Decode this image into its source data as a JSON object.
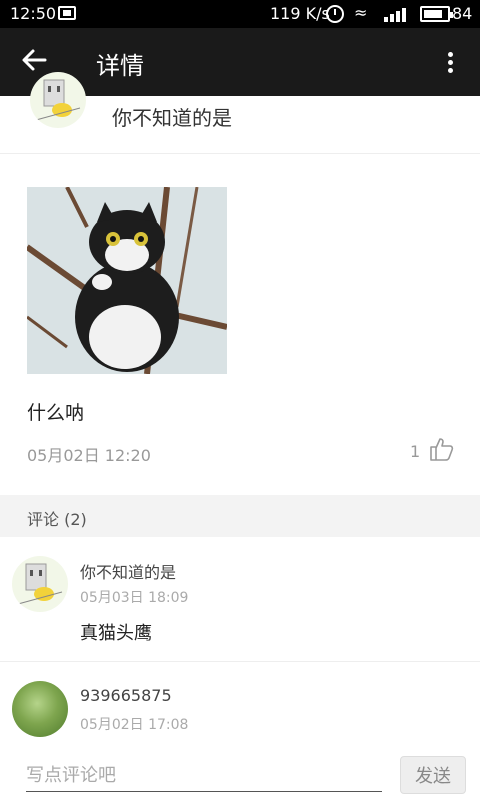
{
  "status_bar": {
    "time": "12:50",
    "network_speed": "119 K/s",
    "battery": "84",
    "battery_level": 0.84
  },
  "app_bar": {
    "title": "详情",
    "back_icon": "arrow-left",
    "menu_icon": "more-vertical"
  },
  "post": {
    "author": "你不知道的是",
    "text": "什么呐",
    "time": "05月02日  12:20",
    "like_count": "1"
  },
  "comments": {
    "header": "评论 (2)",
    "items": [
      {
        "author": "你不知道的是",
        "time": "05月03日  18:09",
        "text": "真猫头鹰"
      },
      {
        "author": "939665875",
        "time": "05月02日  17:08",
        "text": ""
      }
    ]
  },
  "input_bar": {
    "placeholder": "写点评论吧",
    "send_label": "发送"
  }
}
